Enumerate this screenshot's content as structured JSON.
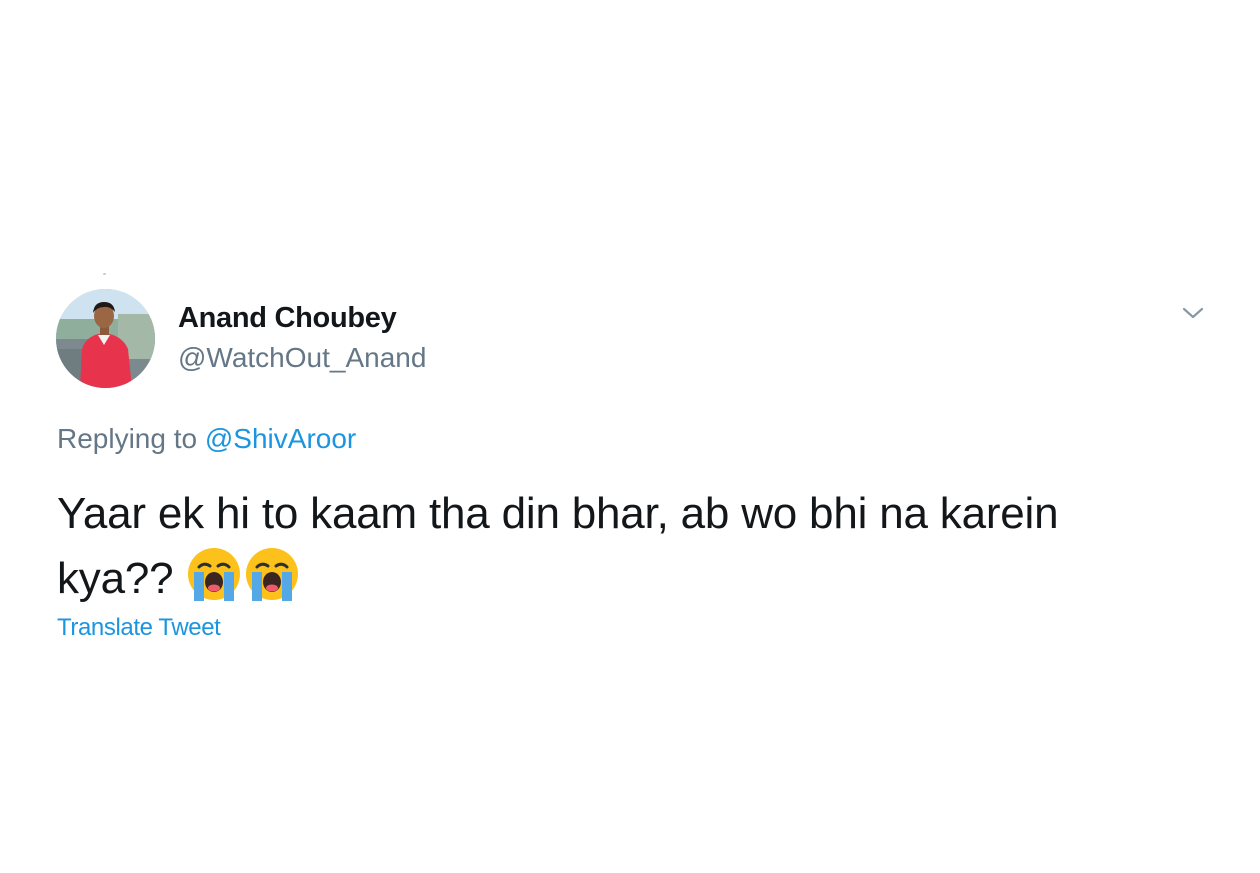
{
  "tweet": {
    "author": {
      "name": "Anand Choubey",
      "handle": "@WatchOut_Anand"
    },
    "replying_to_label": "Replying to",
    "replying_to_mention": "@ShivAroor",
    "text": "Yaar ek hi to kaam tha din bhar, ab wo bhi na karein kya??",
    "emojis": [
      "loudly-crying-face-icon",
      "loudly-crying-face-icon"
    ],
    "translate_label": "Translate Tweet",
    "menu_icon": "chevron-down-icon"
  },
  "colors": {
    "text_primary": "#14171a",
    "text_secondary": "#657786",
    "link": "#1b95e0"
  }
}
